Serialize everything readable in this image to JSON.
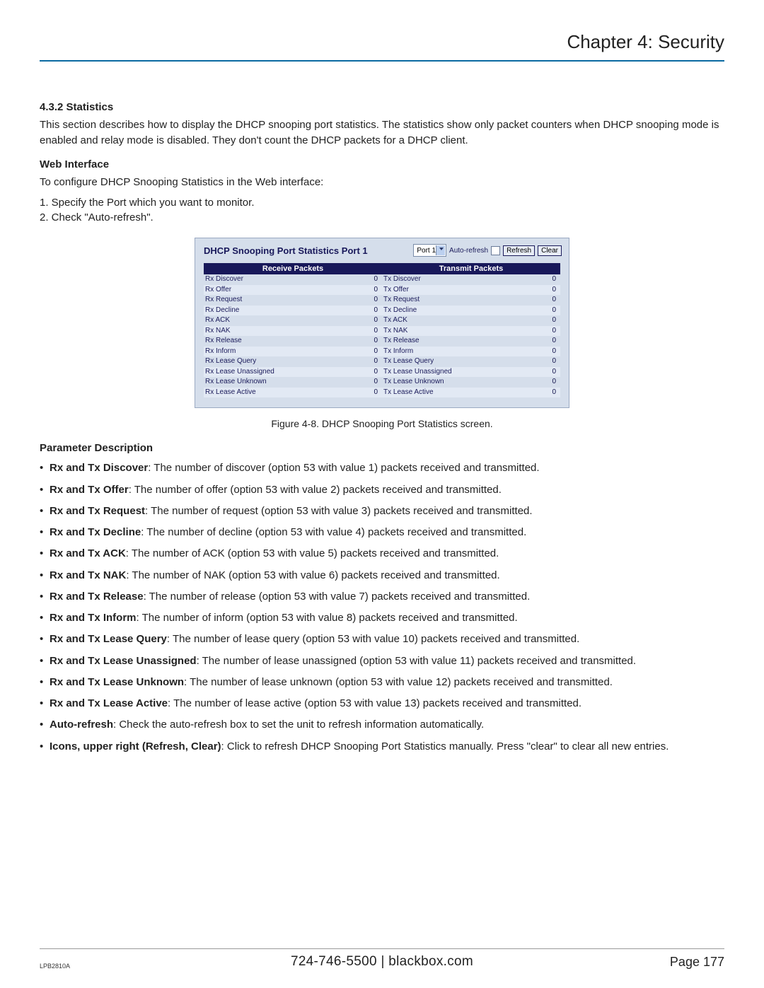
{
  "header": {
    "chapter_title": "Chapter 4: Security"
  },
  "section": {
    "num_title": "4.3.2 Statistics",
    "intro": "This section describes how to display the DHCP snooping port statistics. The statistics show only packet counters when DHCP snooping mode is enabled and relay mode is disabled. They don't count the DHCP packets for a DHCP client.",
    "web_heading": "Web Interface",
    "web_intro": "To configure DHCP Snooping Statistics in the Web interface:",
    "steps": [
      "1. Specify the Port which you want to monitor.",
      "2. Check \"Auto-refresh\"."
    ]
  },
  "screenshot": {
    "title": "DHCP Snooping Port Statistics  Port 1",
    "port_select": "Port 1",
    "autorefresh_label": "Auto-refresh",
    "refresh_btn": "Refresh",
    "clear_btn": "Clear",
    "col_rx": "Receive Packets",
    "col_tx": "Transmit Packets",
    "rows": [
      {
        "rx_label": "Rx Discover",
        "rx_val": "0",
        "tx_label": "Tx Discover",
        "tx_val": "0"
      },
      {
        "rx_label": "Rx Offer",
        "rx_val": "0",
        "tx_label": "Tx Offer",
        "tx_val": "0"
      },
      {
        "rx_label": "Rx Request",
        "rx_val": "0",
        "tx_label": "Tx Request",
        "tx_val": "0"
      },
      {
        "rx_label": "Rx Decline",
        "rx_val": "0",
        "tx_label": "Tx Decline",
        "tx_val": "0"
      },
      {
        "rx_label": "Rx ACK",
        "rx_val": "0",
        "tx_label": "Tx ACK",
        "tx_val": "0"
      },
      {
        "rx_label": "Rx NAK",
        "rx_val": "0",
        "tx_label": "Tx NAK",
        "tx_val": "0"
      },
      {
        "rx_label": "Rx Release",
        "rx_val": "0",
        "tx_label": "Tx Release",
        "tx_val": "0"
      },
      {
        "rx_label": "Rx Inform",
        "rx_val": "0",
        "tx_label": "Tx Inform",
        "tx_val": "0"
      },
      {
        "rx_label": "Rx Lease Query",
        "rx_val": "0",
        "tx_label": "Tx Lease Query",
        "tx_val": "0"
      },
      {
        "rx_label": "Rx Lease Unassigned",
        "rx_val": "0",
        "tx_label": "Tx Lease Unassigned",
        "tx_val": "0"
      },
      {
        "rx_label": "Rx Lease Unknown",
        "rx_val": "0",
        "tx_label": "Tx Lease Unknown",
        "tx_val": "0"
      },
      {
        "rx_label": "Rx Lease Active",
        "rx_val": "0",
        "tx_label": "Tx Lease Active",
        "tx_val": "0"
      }
    ]
  },
  "caption": "Figure 4-8. DHCP Snooping Port Statistics screen.",
  "param_heading": "Parameter Description",
  "params": [
    {
      "term": "Rx and Tx Discover",
      "desc": ": The number of discover (option 53 with value 1) packets received and transmitted."
    },
    {
      "term": "Rx and Tx Offer",
      "desc": ": The number of offer (option 53 with value 2) packets received and transmitted."
    },
    {
      "term": "Rx and Tx Request",
      "desc": ": The number of request (option 53 with value 3) packets received and transmitted."
    },
    {
      "term": "Rx and Tx Decline",
      "desc": ": The number of decline (option 53 with value 4) packets received and transmitted."
    },
    {
      "term": "Rx and Tx ACK",
      "desc": ": The number of ACK (option 53 with value 5) packets received and transmitted."
    },
    {
      "term": "Rx and Tx NAK",
      "desc": ": The number of NAK (option 53 with value 6) packets received and transmitted."
    },
    {
      "term": "Rx and Tx Release",
      "desc": ": The number of release (option 53 with value 7) packets received and transmitted."
    },
    {
      "term": "Rx and Tx Inform",
      "desc": ": The number of inform (option 53 with value 8) packets received and transmitted."
    },
    {
      "term": "Rx and Tx Lease Query",
      "desc": ": The number of lease query (option 53 with value 10) packets received and transmitted."
    },
    {
      "term": "Rx and Tx Lease Unassigned",
      "desc": ": The number of lease unassigned (option 53 with value 11) packets received and transmitted."
    },
    {
      "term": "Rx and Tx Lease Unknown",
      "desc": ": The number of lease unknown (option 53 with value 12) packets received and transmitted."
    },
    {
      "term": "Rx and Tx Lease Active",
      "desc": ": The number of lease active (option 53 with value 13) packets received and transmitted."
    },
    {
      "term": "Auto-refresh",
      "desc": ": Check the auto-refresh box to set the unit to refresh information automatically."
    },
    {
      "term": "Icons, upper right (Refresh, Clear)",
      "desc": ": Click to refresh DHCP Snooping Port Statistics manually. Press \"clear\" to clear all new entries."
    }
  ],
  "footer": {
    "model": "LPB2810A",
    "center": "724-746-5500   |   blackbox.com",
    "page": "Page 177"
  }
}
